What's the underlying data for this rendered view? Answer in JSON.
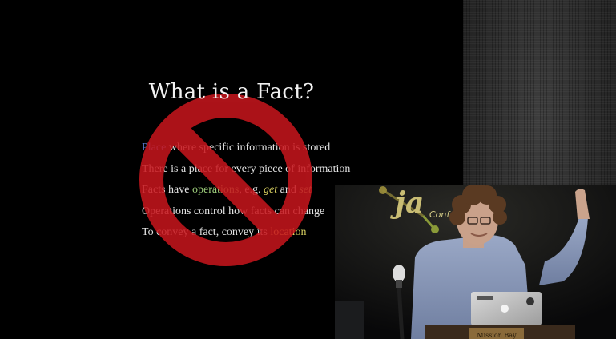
{
  "slide": {
    "title": "What is a Fact?",
    "bullets": [
      {
        "pre": "",
        "hl1": "Place",
        "mid": " where specific information is stored",
        "hl2": "",
        "post": ""
      },
      {
        "pre": "There is a place for every piece of information",
        "hl1": "",
        "mid": "",
        "hl2": "",
        "post": ""
      },
      {
        "pre": "Facts have ",
        "hl1": "operations",
        "mid": ", e.g. ",
        "hl2": "get",
        "between": " and ",
        "hl3": "set",
        "post": ""
      },
      {
        "pre": "Operations control how facts can change",
        "hl1": "",
        "mid": "",
        "hl2": "",
        "post": ""
      },
      {
        "pre": "To convey a fact, convey its ",
        "hl1": "location",
        "mid": "",
        "hl2": "",
        "post": ""
      }
    ],
    "overlay_icon": "prohibition-sign-icon",
    "colors": {
      "prohibition": "#c8161d",
      "highlight_green": "#9ccc7a",
      "highlight_yellow": "#d8d060"
    }
  },
  "video": {
    "banner_text": "Conf",
    "banner_logo_text": "ja",
    "podium_sign": "Mission Bay",
    "laptop_logo": "apple-logo-icon"
  }
}
